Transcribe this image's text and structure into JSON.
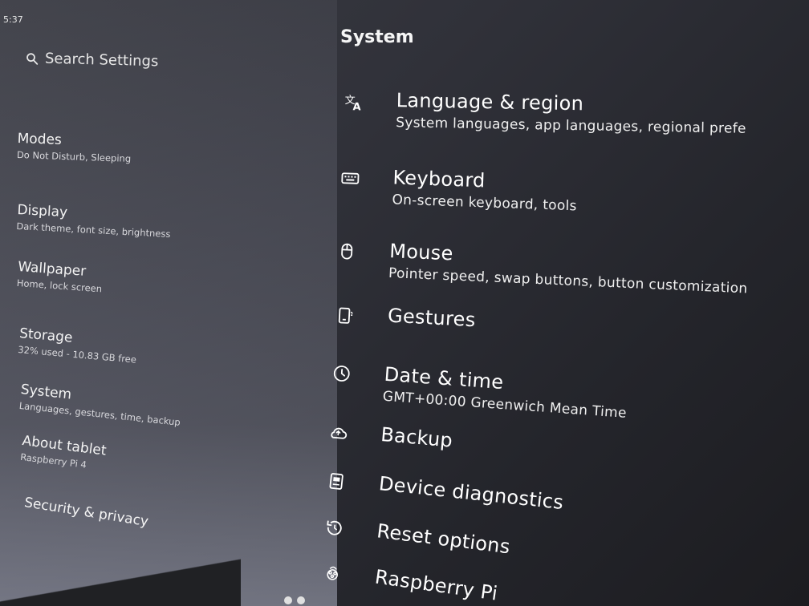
{
  "status_bar": {
    "time": "5:37"
  },
  "sidebar": {
    "search_label": "Search Settings",
    "items": [
      {
        "title": "Modes",
        "subtitle": "Do Not Disturb, Sleeping"
      },
      {
        "title": "Display",
        "subtitle": "Dark theme, font size, brightness"
      },
      {
        "title": "Wallpaper",
        "subtitle": "Home, lock screen"
      },
      {
        "title": "Storage",
        "subtitle": "32% used - 10.83 GB free"
      },
      {
        "title": "System",
        "subtitle": "Languages, gestures, time, backup"
      },
      {
        "title": "About tablet",
        "subtitle": "Raspberry Pi 4"
      },
      {
        "title": "Security & privacy",
        "subtitle": ""
      }
    ]
  },
  "main": {
    "title": "System",
    "items": [
      {
        "title": "Language & region",
        "subtitle": "System languages, app languages, regional prefe",
        "icon": "translate-icon"
      },
      {
        "title": "Keyboard",
        "subtitle": "On-screen keyboard, tools",
        "icon": "keyboard-icon"
      },
      {
        "title": "Mouse",
        "subtitle": "Pointer speed, swap buttons, button customization",
        "icon": "mouse-icon"
      },
      {
        "title": "Gestures",
        "subtitle": "",
        "icon": "gestures-icon"
      },
      {
        "title": "Date & time",
        "subtitle": "GMT+00:00 Greenwich Mean Time",
        "icon": "clock-icon"
      },
      {
        "title": "Backup",
        "subtitle": "",
        "icon": "cloud-backup-icon"
      },
      {
        "title": "Device diagnostics",
        "subtitle": "",
        "icon": "diagnostics-icon"
      },
      {
        "title": "Reset options",
        "subtitle": "",
        "icon": "reset-history-icon"
      },
      {
        "title": "Raspberry Pi",
        "subtitle": "",
        "icon": "raspberry-pi-icon"
      }
    ]
  }
}
